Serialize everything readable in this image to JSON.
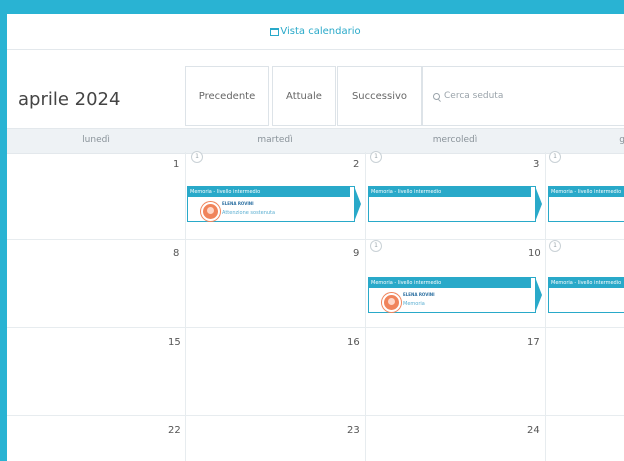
{
  "header": {
    "view_label": "Vista calendario",
    "view_icon": "calendar-icon"
  },
  "toolbar": {
    "month_title": "aprile 2024",
    "prev_label": "Precedente",
    "today_label": "Attuale",
    "next_label": "Successivo",
    "search_placeholder": "Cerca seduta"
  },
  "weekdays": [
    "lunedì",
    "martedì",
    "mercoledì",
    "g"
  ],
  "weeks": [
    {
      "days": [
        "1",
        "2",
        "3"
      ]
    },
    {
      "days": [
        "8",
        "9",
        "10"
      ]
    },
    {
      "days": [
        "15",
        "16",
        "17"
      ]
    },
    {
      "days": [
        "22",
        "23",
        "24"
      ]
    }
  ],
  "badges": [
    "1",
    "1",
    "1",
    "1",
    "1"
  ],
  "events": [
    {
      "title": "Memoria - livello intermedio",
      "name": "ELENA ROVINI",
      "topic": "Attenzione sostenuta"
    },
    {
      "title": "Memoria - livello intermedio",
      "name": "",
      "topic": ""
    },
    {
      "title": "Memoria - livello intermedio",
      "name": "",
      "topic": ""
    },
    {
      "title": "Memoria - livello intermedio",
      "name": "ELENA ROVINI",
      "topic": "Memoria"
    },
    {
      "title": "Memoria - livello intermedio",
      "name": "",
      "topic": ""
    }
  ],
  "colors": {
    "accent": "#29a9c9",
    "frame": "#29b3d3",
    "avatar": "#f0845b"
  }
}
